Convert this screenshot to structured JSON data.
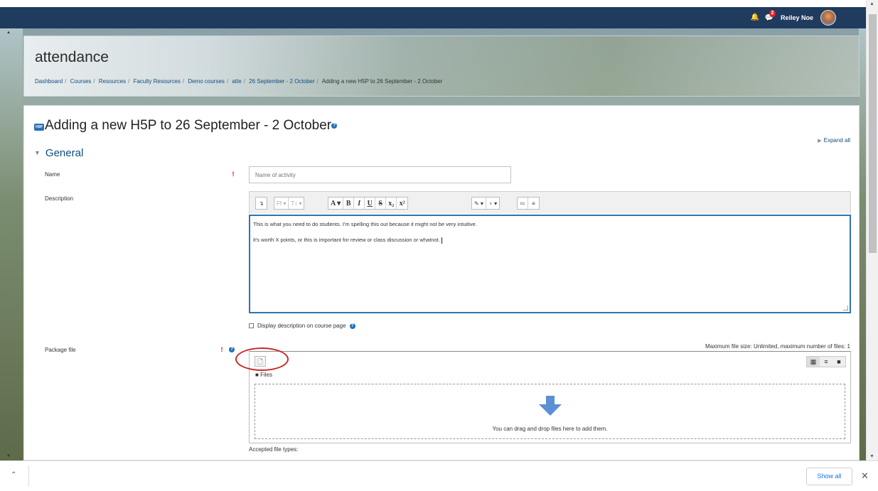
{
  "navbar": {
    "notification_count": "2",
    "user_name": "Reiley Noe"
  },
  "header": {
    "title": "attendance",
    "breadcrumb": [
      "Dashboard",
      "Courses",
      "Resources",
      "Faculty Resources",
      "Demo courses",
      "atte",
      "26 September - 2 October",
      "Adding a new H5P to 26 September - 2 October"
    ]
  },
  "page": {
    "icon_text": "H5P",
    "title": "Adding a new H5P to 26 September - 2 October",
    "expand_all": "Expand all",
    "section": "General"
  },
  "form": {
    "name_label": "Name",
    "name_placeholder": "Name of activity",
    "description_label": "Description",
    "description_paragraphs": [
      "This is what you need to do students. I'm spelling this out because it might not be very intuitive.",
      "it's worth X points, or  this is important for review or class discussion or whatnot."
    ],
    "display_description_label": "Display description on course page",
    "package_file_label": "Package file",
    "max_file_size": "Maximum file size: Unlimited, maximum number of files: 1",
    "files_folder": "Files",
    "drop_text": "You can drag and drop files here to add them.",
    "accepted_file_types": "Accepted file types:"
  },
  "toolbar": {
    "buttons": [
      "↴",
      "Ff ▾",
      "T↕ ▾",
      "A ▾",
      "B",
      "I",
      "U",
      "S",
      "x₂",
      "x²",
      "✎ ▾",
      "♀ ▾",
      "≔",
      "≡"
    ]
  },
  "downloadbar": {
    "show_all": "Show all",
    "close": "✕"
  },
  "colors": {
    "navbar": "#1f3b5e",
    "link": "#0f4c81",
    "required": "#c0201e",
    "editor_focus": "#2f74b3",
    "annotation_circle": "#cc2a2a",
    "drop_arrow": "#5b8fd6"
  }
}
